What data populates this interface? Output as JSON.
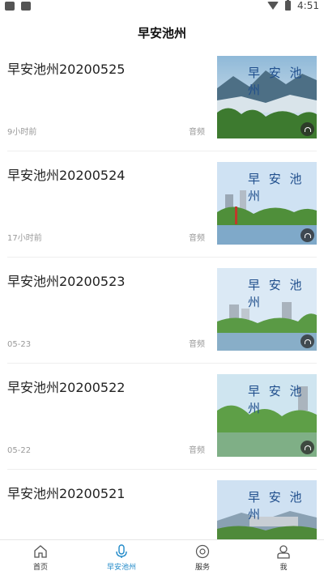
{
  "status_bar": {
    "time": "4:51"
  },
  "header": {
    "title": "早安池州"
  },
  "items": [
    {
      "title": "早安池州20200525",
      "time": "9小时前",
      "type": "音频",
      "thumb_text": "早 安 池 州"
    },
    {
      "title": "早安池州20200524",
      "time": "17小时前",
      "type": "音频",
      "thumb_text": "早 安 池 州"
    },
    {
      "title": "早安池州20200523",
      "time": "05-23",
      "type": "音频",
      "thumb_text": "早 安 池 州"
    },
    {
      "title": "早安池州20200522",
      "time": "05-22",
      "type": "音频",
      "thumb_text": "早 安 池 州"
    },
    {
      "title": "早安池州20200521",
      "time": "",
      "type": "",
      "thumb_text": "早 安 池 州"
    }
  ],
  "tabbar": {
    "items": [
      {
        "label": "首页",
        "icon": "home-icon"
      },
      {
        "label": "早安池州",
        "icon": "microphone-icon",
        "active": true
      },
      {
        "label": "服务",
        "icon": "service-icon"
      },
      {
        "label": "我",
        "icon": "user-icon"
      }
    ]
  },
  "colors": {
    "accent": "#1e88c8",
    "muted": "#999999"
  }
}
